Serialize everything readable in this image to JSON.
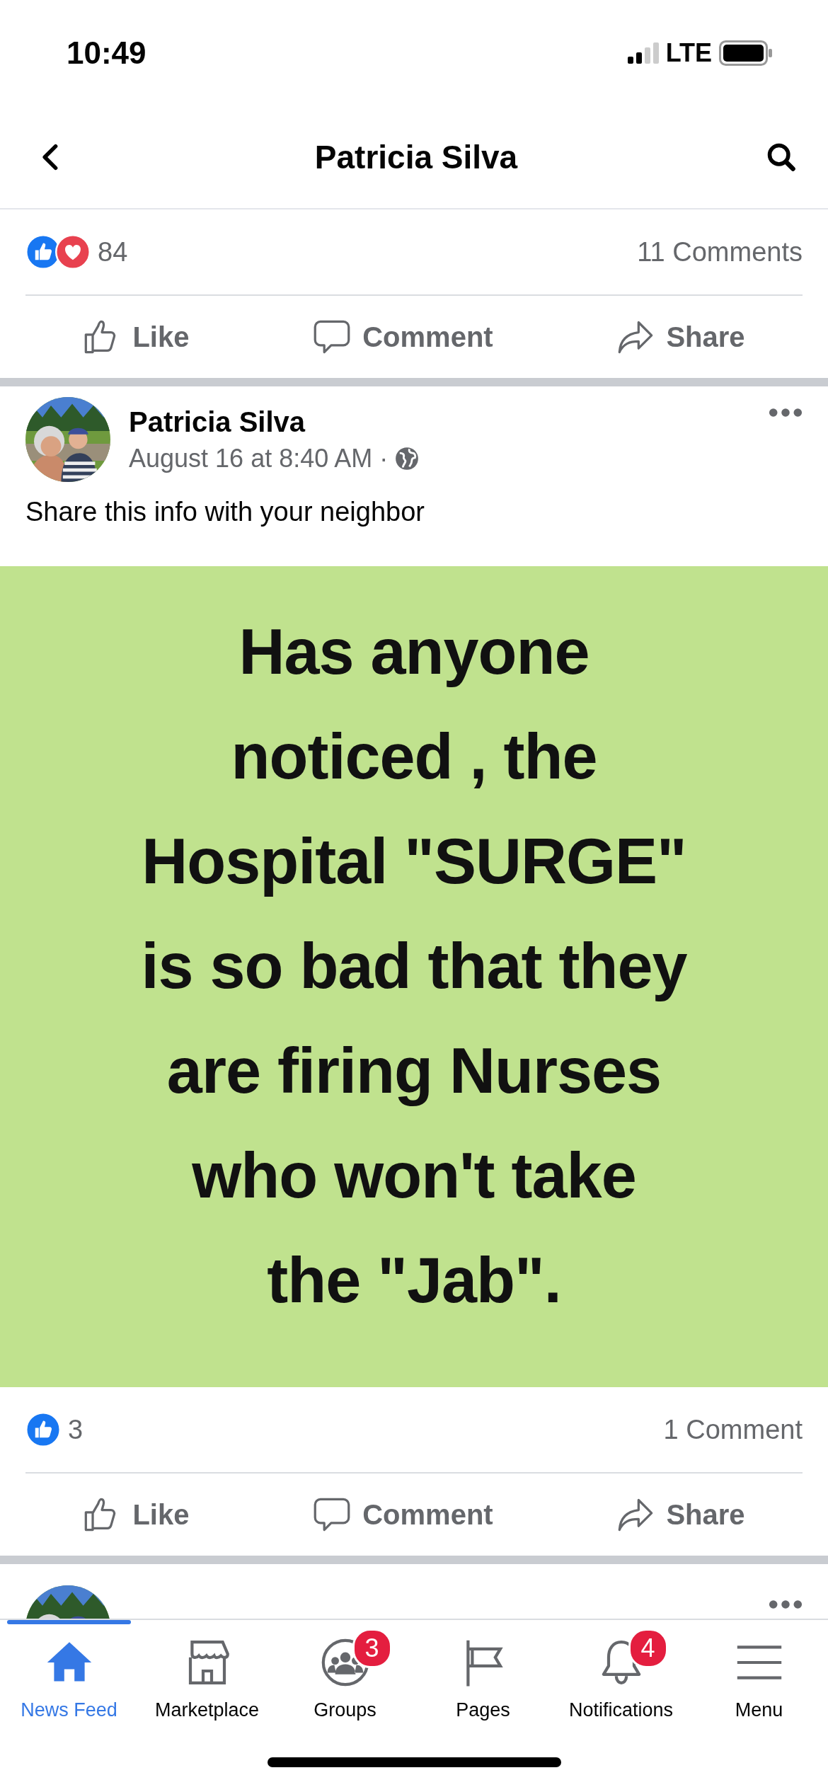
{
  "status_bar": {
    "time": "10:49",
    "network": "LTE"
  },
  "header": {
    "title": "Patricia Silva"
  },
  "posts": [
    {
      "kind": "footer",
      "reactions": {
        "count": "84",
        "icons": [
          {
            "kind": "like"
          },
          {
            "kind": "love"
          }
        ]
      },
      "comments": "11 Comments",
      "actions": [
        {
          "kind": "like",
          "label": "Like"
        },
        {
          "kind": "comment",
          "label": "Comment"
        },
        {
          "kind": "share",
          "label": "Share"
        }
      ]
    },
    {
      "kind": "post",
      "author": "Patricia Silva",
      "time": "August 16 at 8:40 AM ·",
      "text": "Share this info with your neighbor",
      "image_lines": [
        "Has anyone",
        "noticed , the",
        "Hospital \"SURGE\"",
        "is so bad that they",
        "are firing Nurses",
        "who won't take",
        "the \"Jab\"."
      ],
      "reactions": {
        "count": "3",
        "icons": [
          {
            "kind": "like"
          }
        ]
      },
      "comments": "1 Comment",
      "actions": [
        {
          "kind": "like",
          "label": "Like"
        },
        {
          "kind": "comment",
          "label": "Comment"
        },
        {
          "kind": "share",
          "label": "Share"
        }
      ]
    },
    {
      "kind": "partial"
    }
  ],
  "tab_bar": [
    {
      "kind": "home",
      "label": "News Feed",
      "selected": true
    },
    {
      "kind": "store",
      "label": "Marketplace",
      "selected": false
    },
    {
      "kind": "groups",
      "label": "Groups",
      "selected": false,
      "badge": "3"
    },
    {
      "kind": "flag",
      "label": "Pages",
      "selected": false
    },
    {
      "kind": "bell",
      "label": "Notifications",
      "selected": false,
      "badge": "4"
    },
    {
      "kind": "menu",
      "label": "Menu",
      "selected": false
    }
  ]
}
